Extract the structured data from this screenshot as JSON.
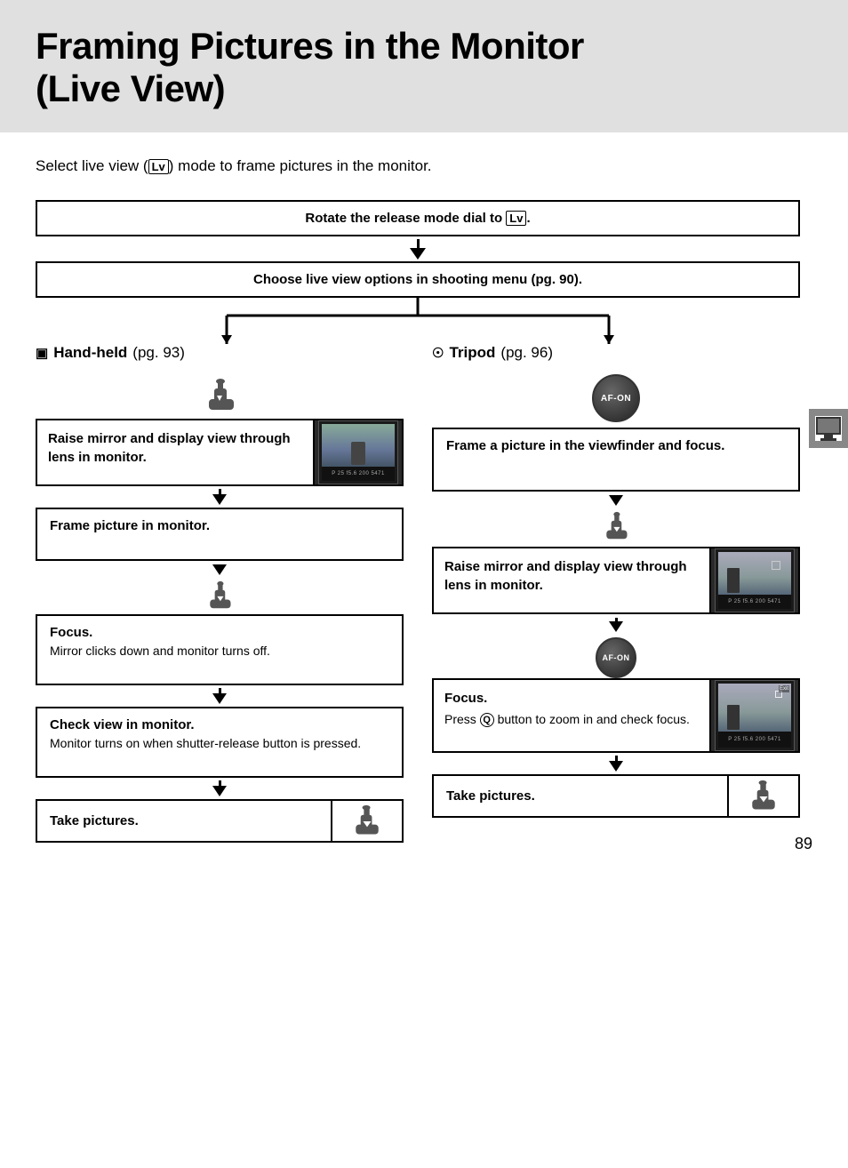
{
  "page": {
    "title_line1": "Framing Pictures in the Monitor",
    "title_line2": "(Live View)",
    "page_number": "89",
    "tab_icon_label": "monitor-tab"
  },
  "intro": {
    "text_before": "Select live view (",
    "lv_symbol": "Lv",
    "text_after": ") mode to frame pictures in the monitor."
  },
  "flowchart": {
    "step1": {
      "text_before": "Rotate the release mode dial to ",
      "lv_symbol": "Lv",
      "text_after": "."
    },
    "step2": {
      "text": "Choose live view options in shooting menu (pg. 90)."
    },
    "left_branch": {
      "header_icon": "🎞",
      "header_label": "Hand-held",
      "header_pg": "(pg. 93)",
      "step_a": {
        "text": "Raise mirror and display view through lens in monitor."
      },
      "step_b": {
        "text": "Frame picture in monitor."
      },
      "step_c_title": "Focus.",
      "step_c_body": "Mirror clicks down and monitor turns off.",
      "step_d_title": "Check view in monitor.",
      "step_d_body": "Monitor turns on when shutter-release button is pressed.",
      "step_e": "Take pictures."
    },
    "right_branch": {
      "header_icon": "🎭",
      "header_label": "Tripod",
      "header_pg": "(pg. 96)",
      "step_a": {
        "text": "Frame a picture in the viewfinder and focus."
      },
      "step_b": {
        "text": "Raise mirror and display view through lens in monitor."
      },
      "step_c_title": "Focus.",
      "step_c_body_before": "Press ",
      "step_c_zoom": "Q",
      "step_c_body_after": " button to zoom in and check focus.",
      "step_d": "Take pictures."
    }
  }
}
